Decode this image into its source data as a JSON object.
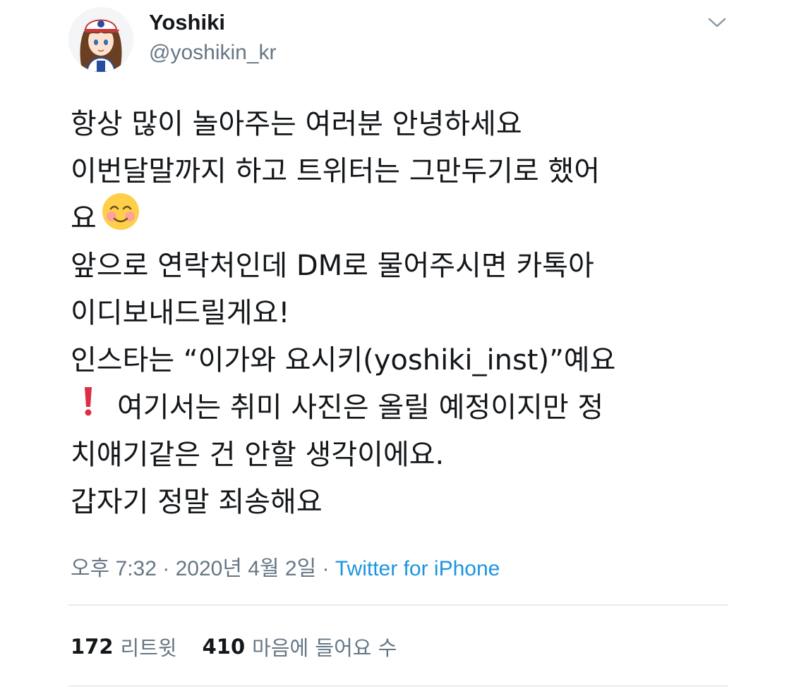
{
  "author": {
    "display_name": "Yoshiki",
    "handle": "@yoshikin_kr",
    "avatar_icon": "anime-girl-avatar"
  },
  "tweet": {
    "lines": [
      "항상 많이 놀아주는 여러분 안녕하세요",
      "이번달말까지 하고 트위터는 그만두기로 했어",
      "요",
      "앞으로 연락처인데 DM로 물어주시면 카톡아",
      "이디보내드릴게요!",
      "인스타는 “이가와 요시키(yoshiki_inst)”예요",
      "여기서는 취미 사진은 올릴 예정이지만 정",
      "치얘기같은 건 안할 생각이에요.",
      "갑자기 정말 죄송해요"
    ],
    "emoji_icon": "smiling-face-icon",
    "exclamation_icon": "red-exclamation-icon"
  },
  "meta": {
    "time": "오후 7:32",
    "date": "2020년 4월 2일",
    "separator": "·",
    "source": "Twitter for iPhone"
  },
  "stats": {
    "retweets_count": "172",
    "retweets_label": "리트윗",
    "likes_count": "410",
    "likes_label": "마음에 들어요 수"
  },
  "colors": {
    "text": "#14171a",
    "secondary": "#657786",
    "link": "#1b95e0",
    "divider": "#e6ecf0"
  }
}
